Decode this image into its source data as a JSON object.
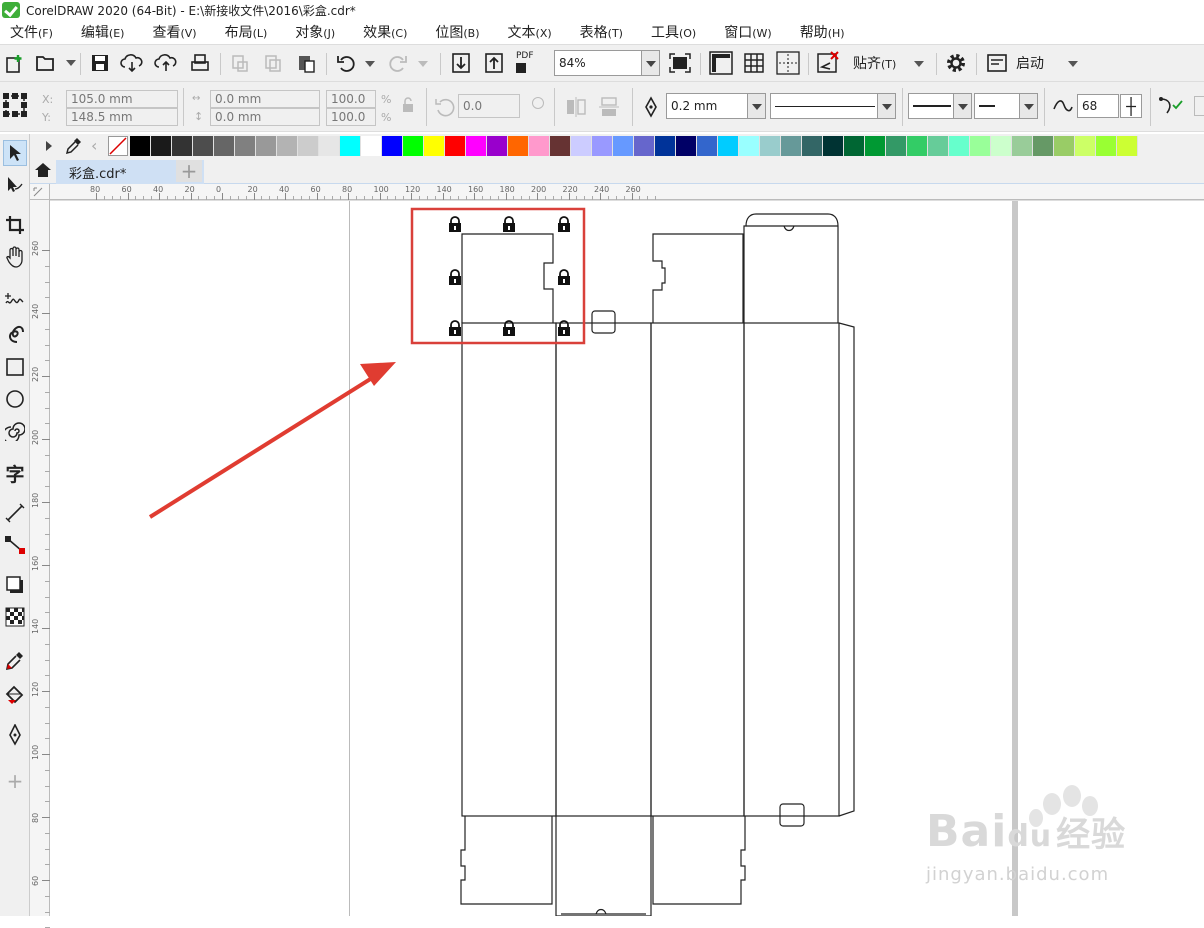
{
  "titlebar": {
    "title": "CorelDRAW 2020 (64-Bit) - E:\\新接收文件\\2016\\彩盒.cdr*"
  },
  "menu": [
    {
      "label": "文件",
      "key": "(F)"
    },
    {
      "label": "编辑",
      "key": "(E)"
    },
    {
      "label": "查看",
      "key": "(V)"
    },
    {
      "label": "布局",
      "key": "(L)"
    },
    {
      "label": "对象",
      "key": "(J)"
    },
    {
      "label": "效果",
      "key": "(C)"
    },
    {
      "label": "位图",
      "key": "(B)"
    },
    {
      "label": "文本",
      "key": "(X)"
    },
    {
      "label": "表格",
      "key": "(T)"
    },
    {
      "label": "工具",
      "key": "(O)"
    },
    {
      "label": "窗口",
      "key": "(W)"
    },
    {
      "label": "帮助",
      "key": "(H)"
    }
  ],
  "toolbar": {
    "zoom_value": "84%",
    "pdf_label": "PDF",
    "snap_label": "贴齐",
    "snap_key": "(T)",
    "launch_label": "启动"
  },
  "propertybar": {
    "x_label": "X:",
    "y_label": "Y:",
    "x_value": "105.0 mm",
    "y_value": "148.5 mm",
    "w_value": "0.0 mm",
    "h_value": "0.0 mm",
    "scale_x": "100.0",
    "scale_y": "100.0",
    "percent": "%",
    "rotation": "0.0",
    "outline_width": "0.2 mm",
    "smoothing": "68"
  },
  "tab": {
    "label": "彩盒.cdr*",
    "add": "+"
  },
  "ruler": {
    "h_ticks": [
      "80",
      "60",
      "40",
      "20",
      "0",
      "20",
      "40",
      "60",
      "80",
      "100",
      "120",
      "140",
      "160",
      "180",
      "200",
      "220",
      "240",
      "260"
    ],
    "v_ticks": [
      "260",
      "240",
      "220",
      "200",
      "180",
      "160",
      "140",
      "120",
      "100",
      "80",
      "60"
    ]
  },
  "palette_colors": [
    "#000000",
    "#1a1a1a",
    "#333333",
    "#4d4d4d",
    "#666666",
    "#808080",
    "#999999",
    "#b3b3b3",
    "#cccccc",
    "#e6e6e6",
    "#00ffff",
    "#ffffff",
    "#0000ff",
    "#00ff00",
    "#ffff00",
    "#ff0000",
    "#ff00ff",
    "#9900cc",
    "#ff6600",
    "#ff99cc",
    "#663333",
    "#ccccff",
    "#9999ff",
    "#6699ff",
    "#6666cc",
    "#003399",
    "#000066",
    "#3366cc",
    "#00ccff",
    "#99ffff",
    "#99cccc",
    "#669999",
    "#336666",
    "#003333",
    "#006633",
    "#009933",
    "#339966",
    "#33cc66",
    "#66cc99",
    "#66ffcc",
    "#99ff99",
    "#ccffcc",
    "#99cc99",
    "#669966",
    "#99cc66",
    "#ccff66",
    "#99ff33",
    "#ccff33"
  ],
  "watermark": {
    "brand": "Bai",
    "brand2": "du",
    "cn": "经验",
    "url": "jingyan.baidu.com"
  }
}
